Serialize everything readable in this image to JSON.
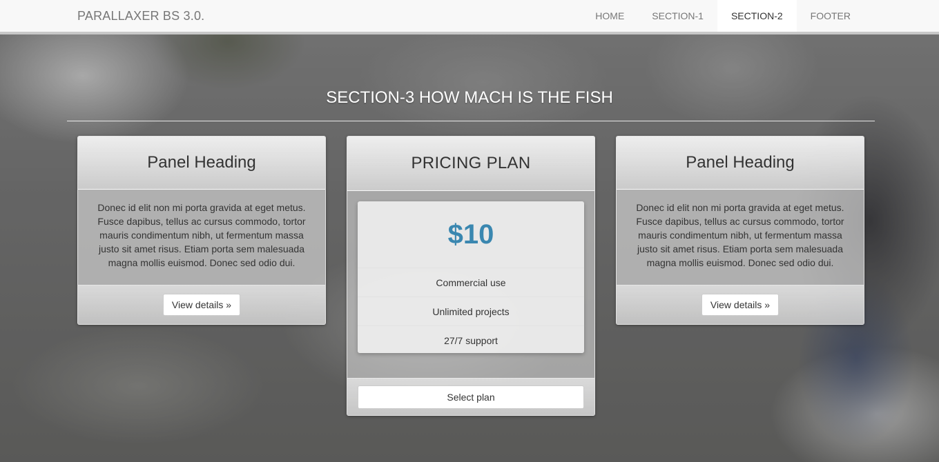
{
  "navbar": {
    "brand": "PARALLAXER BS 3.0.",
    "items": [
      {
        "label": "HOME"
      },
      {
        "label": "SECTION-1"
      },
      {
        "label": "SECTION-2",
        "active": true
      },
      {
        "label": "FOOTER"
      }
    ]
  },
  "section": {
    "title": "SECTION-3 HOW MACH IS THE FISH"
  },
  "panels": {
    "left": {
      "heading": "Panel Heading",
      "body": "Donec id elit non mi porta gravida at eget metus. Fusce dapibus, tellus ac cursus commodo, tortor mauris condimentum nibh, ut fermentum massa justo sit amet risus. Etiam porta sem malesuada magna mollis euismod. Donec sed odio dui.",
      "button": "View details »"
    },
    "pricing": {
      "heading": "PRICING PLAN",
      "price": "$10",
      "features": [
        "Commercial use",
        "Unlimited projects",
        "27/7 support"
      ],
      "button": "Select plan"
    },
    "right": {
      "heading": "Panel Heading",
      "body": "Donec id elit non mi porta gravida at eget metus. Fusce dapibus, tellus ac cursus commodo, tortor mauris condimentum nibh, ut fermentum massa justo sit amet risus. Etiam porta sem malesuada magna mollis euismod. Donec sed odio dui.",
      "button": "View details »"
    }
  },
  "colors": {
    "price": "#3a87b0",
    "navbar_bg": "#f8f8f8",
    "active_nav_bg": "#ffffff"
  }
}
